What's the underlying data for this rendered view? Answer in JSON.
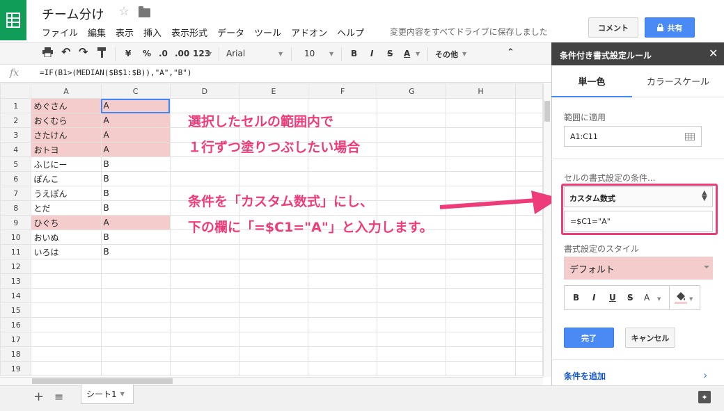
{
  "header": {
    "doc_title": "チーム分け",
    "menu": [
      "ファイル",
      "編集",
      "表示",
      "挿入",
      "表示形式",
      "データ",
      "ツール",
      "アドオン",
      "ヘルプ"
    ],
    "save_status": "変更内容をすべてドライブに保存しました",
    "comment_label": "コメント",
    "share_label": "共有"
  },
  "toolbar": {
    "currency": "¥",
    "percent": "%",
    "decrease_decimal": ".0",
    "increase_decimal": ".00",
    "number_format": "123",
    "font": "Arial",
    "font_size": "10",
    "bold": "B",
    "italic": "I",
    "strike": "S",
    "text_color": "A",
    "more": "その他"
  },
  "formula_bar": {
    "fx": "fx",
    "formula": "=IF(B1>(MEDIAN($B$1:$B)),\"A\",\"B\")"
  },
  "grid": {
    "columns": [
      "A",
      "C",
      "D",
      "E",
      "F",
      "G",
      "H"
    ],
    "rows": [
      {
        "n": "1",
        "a": "めぐさん",
        "c": "A",
        "hl": true
      },
      {
        "n": "2",
        "a": "おくむら",
        "c": "A",
        "hl": true
      },
      {
        "n": "3",
        "a": "さたけん",
        "c": "A",
        "hl": true
      },
      {
        "n": "4",
        "a": "おトヨ",
        "c": "A",
        "hl": true
      },
      {
        "n": "5",
        "a": "ふじにー",
        "c": "B",
        "hl": false
      },
      {
        "n": "6",
        "a": "ぽんこ",
        "c": "B",
        "hl": false
      },
      {
        "n": "7",
        "a": "うえぽん",
        "c": "B",
        "hl": false
      },
      {
        "n": "8",
        "a": "とだ",
        "c": "B",
        "hl": false
      },
      {
        "n": "9",
        "a": "ひぐち",
        "c": "A",
        "hl": true
      },
      {
        "n": "10",
        "a": "おいぬ",
        "c": "B",
        "hl": false
      },
      {
        "n": "11",
        "a": "いろは",
        "c": "B",
        "hl": false
      },
      {
        "n": "12",
        "a": "",
        "c": "",
        "hl": false
      },
      {
        "n": "13",
        "a": "",
        "c": "",
        "hl": false
      },
      {
        "n": "14",
        "a": "",
        "c": "",
        "hl": false
      },
      {
        "n": "15",
        "a": "",
        "c": "",
        "hl": false
      },
      {
        "n": "16",
        "a": "",
        "c": "",
        "hl": false
      },
      {
        "n": "17",
        "a": "",
        "c": "",
        "hl": false
      },
      {
        "n": "18",
        "a": "",
        "c": "",
        "hl": false
      },
      {
        "n": "19",
        "a": "",
        "c": "",
        "hl": false
      }
    ]
  },
  "annotations": {
    "line1": "選択したセルの範囲内で",
    "line2": "１行ずつ塗りつぶしたい場合",
    "line3": "条件を「カスタム数式」にし、",
    "line4": "下の欄に「=$C1=\"A\"」と入力します。",
    "color": "#ee3c7a"
  },
  "sheet_bar": {
    "add": "+",
    "list": "≡",
    "tab_label": "シート1"
  },
  "panel": {
    "title": "条件付き書式設定ルール",
    "tab_single": "単一色",
    "tab_scale": "カラースケール",
    "range_label": "範囲に適用",
    "range_value": "A1:C11",
    "condition_label": "セルの書式設定の条件...",
    "condition_value": "カスタム数式",
    "formula_value": "=$C1=\"A\"",
    "style_label": "書式設定のスタイル",
    "style_value": "デフォルト",
    "fmt_bold": "B",
    "fmt_italic": "I",
    "fmt_underline": "U",
    "fmt_strike": "S",
    "fmt_color": "A",
    "done_label": "完了",
    "cancel_label": "キャンセル",
    "add_rule_label": "条件を追加"
  },
  "colors": {
    "highlight": "#f4cccc",
    "accent_blue": "#4a8af4",
    "brand_green": "#0f9d58"
  }
}
